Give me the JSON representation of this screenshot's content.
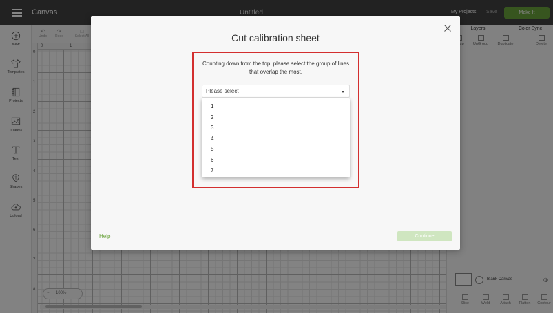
{
  "topbar": {
    "app_title": "Canvas",
    "document_title": "Untitled",
    "my_projects": "My Projects",
    "save": "Save",
    "make_it": "Make It"
  },
  "leftbar": {
    "items": [
      {
        "label": "New",
        "icon": "plus-circle-icon"
      },
      {
        "label": "Templates",
        "icon": "shirt-icon"
      },
      {
        "label": "Projects",
        "icon": "notebook-icon"
      },
      {
        "label": "Images",
        "icon": "image-icon"
      },
      {
        "label": "Text",
        "icon": "text-icon"
      },
      {
        "label": "Shapes",
        "icon": "shapes-icon"
      },
      {
        "label": "Upload",
        "icon": "cloud-upload-icon"
      }
    ]
  },
  "editbar": {
    "undo": "Undo",
    "redo": "Redo",
    "select_all": "Select All"
  },
  "canvas": {
    "ruler_top": [
      "0",
      "1"
    ],
    "ruler_left": [
      "0",
      "1",
      "2",
      "3",
      "4",
      "5",
      "6",
      "7",
      "8"
    ],
    "zoom": "100%"
  },
  "rightpanel": {
    "tabs": [
      "Layers",
      "Color Sync"
    ],
    "tools": [
      "Group",
      "UnGroup",
      "Duplicate",
      "Delete"
    ],
    "blank_canvas_label": "Blank Canvas",
    "bottom_tools": [
      "Slice",
      "Weld",
      "Attach",
      "Flatten",
      "Contour"
    ]
  },
  "modal": {
    "title": "Cut calibration sheet",
    "instruction": "Counting down from the top, please select the group of lines that overlap the most.",
    "select_placeholder": "Please select",
    "options": [
      "1",
      "2",
      "3",
      "4",
      "5",
      "6",
      "7"
    ],
    "help": "Help",
    "continue": "Continue",
    "highlight_color": "#d32f2f",
    "accent_color": "#6aa33c"
  }
}
